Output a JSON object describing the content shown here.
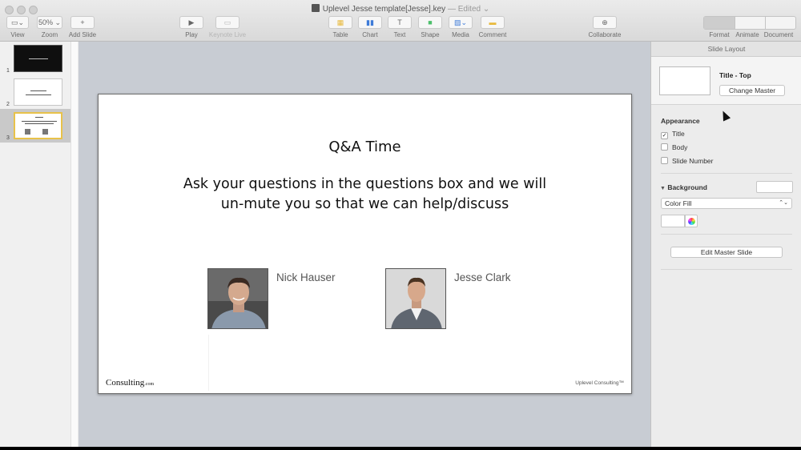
{
  "window": {
    "title": "Uplevel Jesse template[Jesse].key",
    "edited": "— Edited ⌄"
  },
  "toolbar": {
    "view": "View",
    "zoom": "Zoom",
    "zoom_value": "50% ⌄",
    "add_slide": "Add Slide",
    "play": "Play",
    "keynote_live": "Keynote Live",
    "table": "Table",
    "chart": "Chart",
    "text": "Text",
    "text_icon": "T",
    "shape": "Shape",
    "media": "Media",
    "comment": "Comment",
    "collaborate": "Collaborate",
    "format": "Format",
    "animate": "Animate",
    "document": "Document"
  },
  "navigator": {
    "slides": [
      {
        "number": "1"
      },
      {
        "number": "2"
      },
      {
        "number": "3"
      }
    ]
  },
  "slide": {
    "title": "Q&A Time",
    "body_line1": "Ask your questions in the questions box and we will",
    "body_line2": "un-mute you so that we can help/discuss",
    "person1": "Nick Hauser",
    "person2": "Jesse Clark",
    "logo": "Consulting",
    "logo_suffix": ".com",
    "footer": "Uplevel Consulting™"
  },
  "inspector": {
    "header": "Slide Layout",
    "master_name": "Title - Top",
    "change_master": "Change Master",
    "appearance": "Appearance",
    "title_checkbox": "Title",
    "body_checkbox": "Body",
    "slide_number_checkbox": "Slide Number",
    "background": "Background",
    "color_fill": "Color Fill",
    "edit_master": "Edit Master Slide"
  },
  "colors": {
    "canvas_bg": "#c8ccd3",
    "selected_thumb_border": "#e8c24a"
  }
}
